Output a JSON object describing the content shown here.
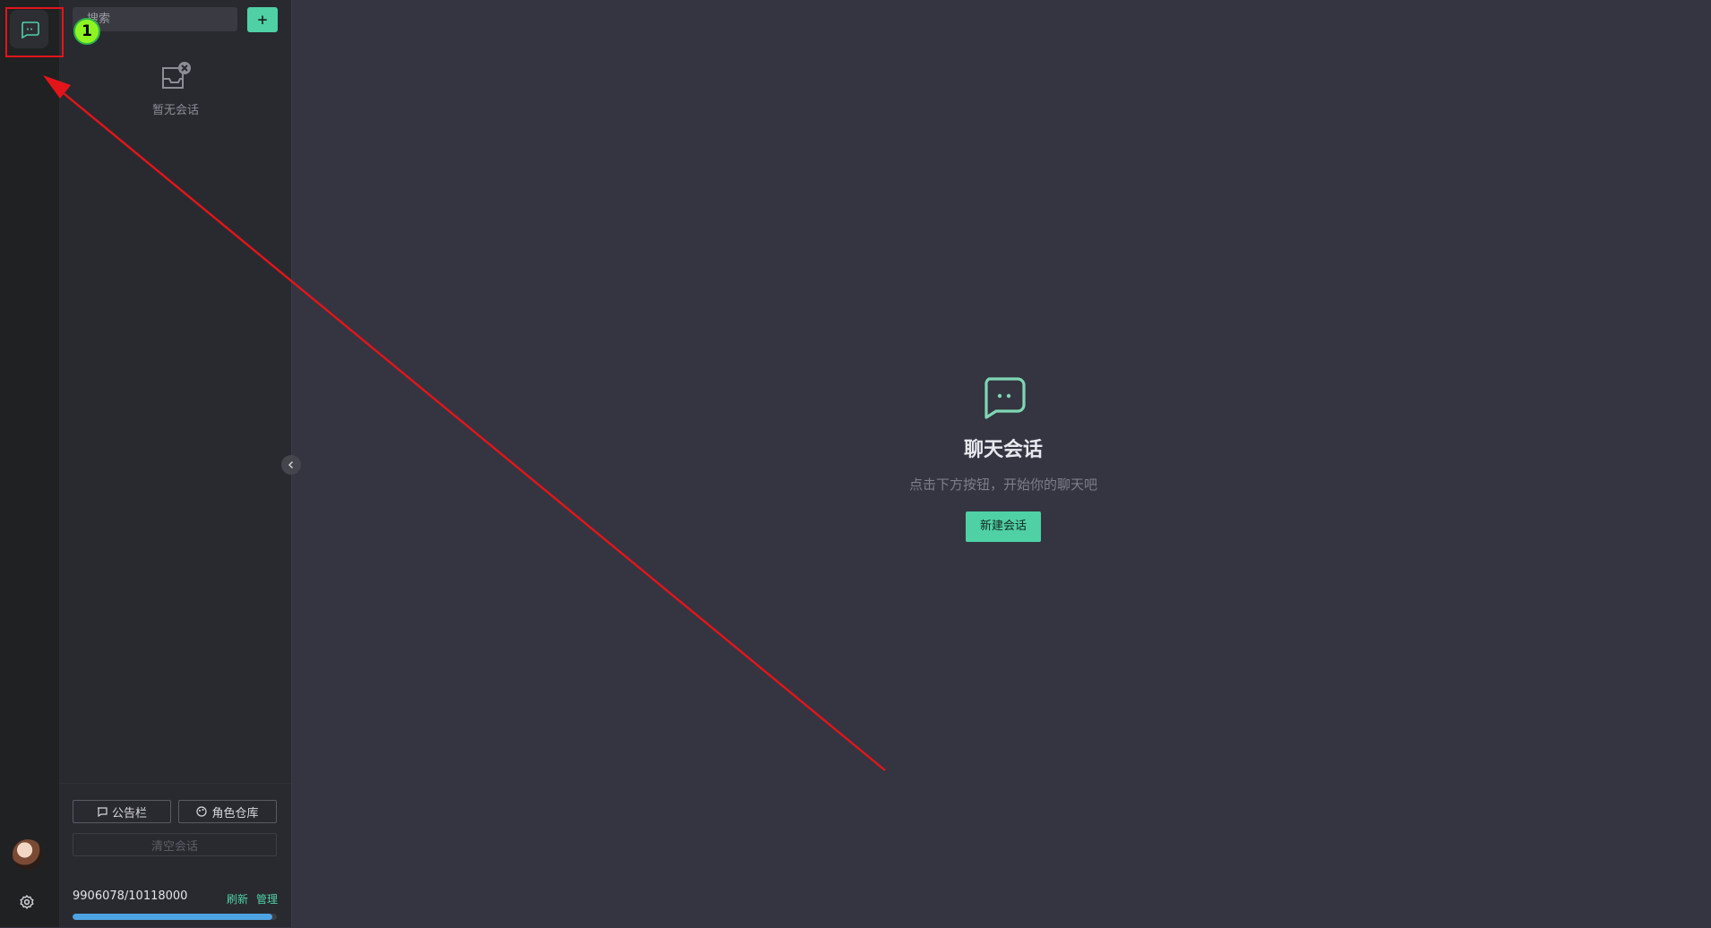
{
  "rail": {
    "icons": [
      "chat-bubble-icon",
      "gear-icon"
    ]
  },
  "sidebar": {
    "search_placeholder": "搜索",
    "add_label": "+",
    "empty_text": "暂无会话",
    "footer": {
      "announcement_label": "公告栏",
      "roles_label": "角色仓库",
      "clear_label": "清空会话",
      "quota_text": "9906078/10118000",
      "refresh_label": "刷新",
      "manage_label": "管理",
      "quota_fraction": 0.979
    }
  },
  "main": {
    "title": "聊天会话",
    "subtitle": "点击下方按钮，开始你的聊天吧",
    "new_chat_label": "新建会话"
  },
  "annotation": {
    "badge_number": "1"
  },
  "colors": {
    "accent": "#4fd1a5",
    "background": "#343541",
    "sidebar": "#292a2f",
    "rail": "#202123",
    "progress": "#4ea3e3",
    "annotation_red": "#e3151a"
  }
}
